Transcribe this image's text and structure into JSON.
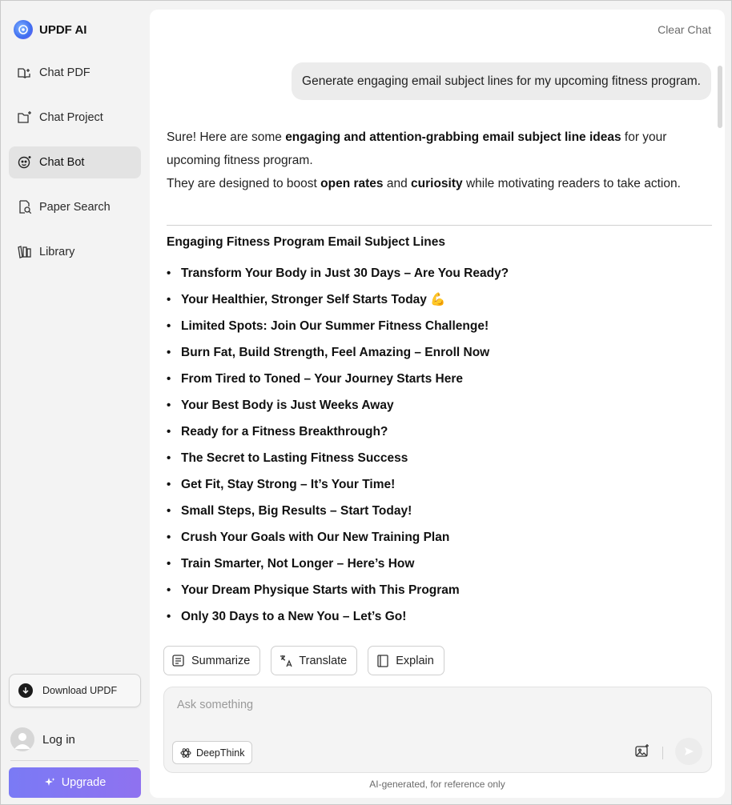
{
  "app": {
    "name": "UPDF AI"
  },
  "sidebar": {
    "items": [
      {
        "label": "Chat PDF",
        "icon": "book-sparkle-icon",
        "active": false
      },
      {
        "label": "Chat Project",
        "icon": "folder-sparkle-icon",
        "active": false
      },
      {
        "label": "Chat Bot",
        "icon": "bot-face-icon",
        "active": true
      },
      {
        "label": "Paper Search",
        "icon": "doc-search-icon",
        "active": false
      },
      {
        "label": "Library",
        "icon": "library-icon",
        "active": false
      }
    ],
    "download_label": "Download UPDF",
    "login_label": "Log in",
    "upgrade_label": "Upgrade"
  },
  "header": {
    "clear_chat": "Clear Chat"
  },
  "conversation": {
    "user_message": "Generate engaging email subject lines for my upcoming fitness program.",
    "answer": {
      "p1_a": "Sure! Here are some ",
      "p1_b": "engaging and attention-grabbing email subject line ideas",
      "p1_c": " for your upcoming fitness program.",
      "p2_a": "They are designed to boost ",
      "p2_b": "open rates",
      "p2_c": " and ",
      "p2_d": "curiosity",
      "p2_e": " while motivating readers to take action."
    },
    "list_title": "Engaging Fitness Program Email Subject Lines",
    "subject_lines": [
      "Transform Your Body in Just 30 Days – Are You Ready?",
      "Your Healthier, Stronger Self Starts Today 💪",
      "Limited Spots: Join Our Summer Fitness Challenge!",
      "Burn Fat, Build Strength, Feel Amazing – Enroll Now",
      "From Tired to Toned – Your Journey Starts Here",
      "Your Best Body is Just Weeks Away",
      "Ready for a Fitness Breakthrough?",
      "The Secret to Lasting Fitness Success",
      "Get Fit, Stay Strong – It’s Your Time!",
      "Small Steps, Big Results – Start Today!",
      "Crush Your Goals with Our New Training Plan",
      "Train Smarter, Not Longer – Here’s How",
      "Your Dream Physique Starts with This Program",
      "Only 30 Days to a New You – Let’s Go!"
    ],
    "bullet": "•"
  },
  "actions": {
    "summarize": "Summarize",
    "translate": "Translate",
    "explain": "Explain"
  },
  "composer": {
    "placeholder": "Ask something",
    "deepthink_label": "DeepThink"
  },
  "footer": {
    "note": "AI-generated, for reference only"
  },
  "colors": {
    "upgrade_gradient_start": "#7a7af5",
    "upgrade_gradient_end": "#8f72f0",
    "active_nav_bg": "#e3e3e3"
  }
}
